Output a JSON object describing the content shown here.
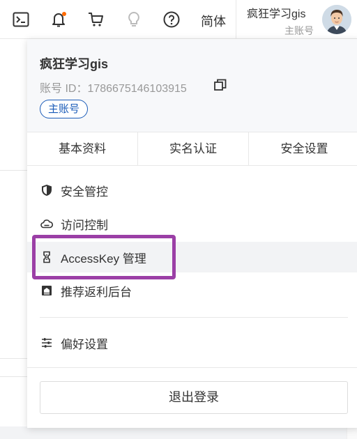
{
  "topbar": {
    "lang_label": "简体",
    "user_name": "疯狂学习gis",
    "user_role": "主账号"
  },
  "panel": {
    "name": "疯狂学习gis",
    "account_id": "账号 ID：1786675146103915",
    "account_tag": "主账号",
    "tabs": [
      {
        "label": "基本资料"
      },
      {
        "label": "实名认证"
      },
      {
        "label": "安全设置"
      }
    ],
    "menu": [
      {
        "label": "安全管控",
        "icon": "shield-icon"
      },
      {
        "label": "访问控制",
        "icon": "cloud-icon"
      },
      {
        "label": "AccessKey 管理",
        "icon": "key-icon"
      },
      {
        "label": "推荐返利后台",
        "icon": "rebate-icon"
      },
      {
        "label": "偏好设置",
        "icon": "sliders-icon"
      }
    ],
    "logout_label": "退出登录"
  },
  "colors": {
    "accent_blue": "#1a5bb8",
    "highlight": "#9b3fa6",
    "notification_dot": "#ff6a00"
  }
}
